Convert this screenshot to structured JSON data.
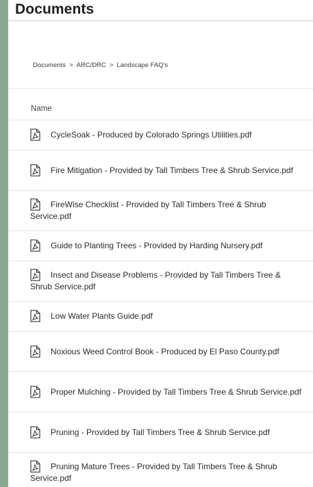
{
  "header": {
    "title": "Documents"
  },
  "breadcrumb": {
    "items": [
      "Documents",
      "ARC/DRC",
      "Landscape FAQ's"
    ],
    "separator": ">"
  },
  "table": {
    "column_name": "Name"
  },
  "files": [
    {
      "name": "CycleSoak - Produced by Colorado Springs Utilities.pdf",
      "icon": "pdf-file-icon"
    },
    {
      "name": "Fire Mitigation - Provided by Tall Timbers Tree & Shrub Service.pdf",
      "icon": "pdf-file-icon"
    },
    {
      "name": "FireWise Checklist - Provided by Tall Timbers Tree & Shrub Service.pdf",
      "icon": "pdf-file-icon"
    },
    {
      "name": "Guide to Planting Trees - Provided by Harding Nursery.pdf",
      "icon": "pdf-file-icon"
    },
    {
      "name": "Insect and Disease Problems - Provided by Tall Timbers Tree & Shrub Service.pdf",
      "icon": "pdf-file-icon"
    },
    {
      "name": "Low Water Plants Guide.pdf",
      "icon": "pdf-file-icon"
    },
    {
      "name": "Noxious Weed Control Book - Produced by El Paso County.pdf",
      "icon": "pdf-file-icon"
    },
    {
      "name": "Proper Mulching - Provided by Tall Timbers Tree & Shrub Service.pdf",
      "icon": "pdf-file-icon"
    },
    {
      "name": "Pruning - Provided by Tall Timbers Tree & Shrub Service.pdf",
      "icon": "pdf-file-icon"
    },
    {
      "name": "Pruning Mature Trees - Provided by Tall Timbers Tree & Shrub Service.pdf",
      "icon": "pdf-file-icon"
    }
  ],
  "colors": {
    "background": "#8aa890",
    "panel": "#ffffff",
    "text": "#2b2b2b",
    "divider": "#e4e4e4"
  }
}
